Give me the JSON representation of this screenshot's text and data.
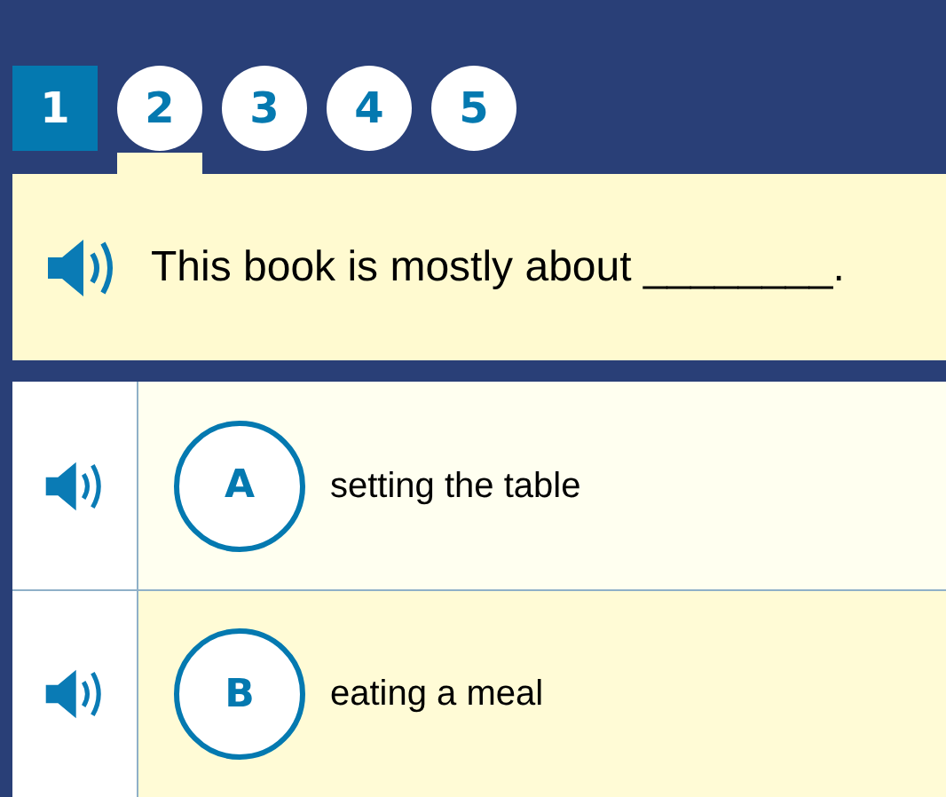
{
  "tabs": [
    {
      "label": "1",
      "selected": false,
      "answered": true
    },
    {
      "label": "2",
      "selected": true,
      "answered": false
    },
    {
      "label": "3",
      "selected": false,
      "answered": false
    },
    {
      "label": "4",
      "selected": false,
      "answered": false
    },
    {
      "label": "5",
      "selected": false,
      "answered": false
    }
  ],
  "question": {
    "text": "This book is mostly about ________."
  },
  "answers": [
    {
      "letter": "A",
      "text": "setting the table"
    },
    {
      "letter": "B",
      "text": "eating a meal"
    }
  ]
}
